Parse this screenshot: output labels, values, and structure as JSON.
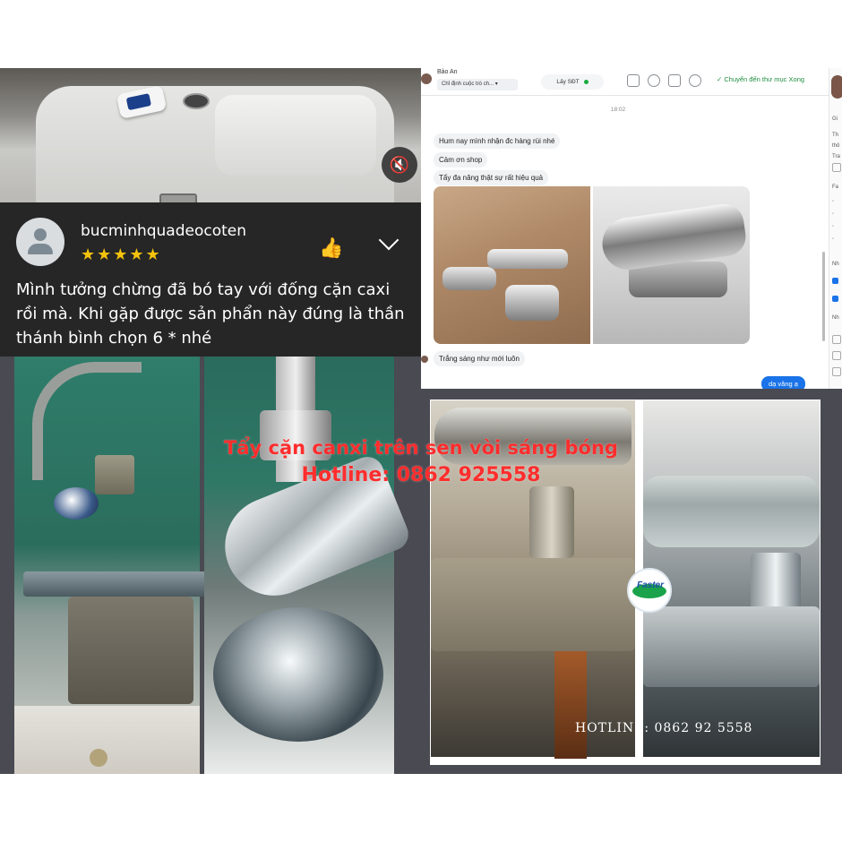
{
  "review": {
    "username": "bucminhquadeocoten",
    "stars": "★★★★★",
    "comment": "Mình tưởng chừng đã bó tay với đống cặn caxi rồi mà. Khi gặp được sản phẩn này đúng là thần thánh bình chọn 6 * nhé"
  },
  "chat": {
    "contact_name": "Bảo An",
    "dropdown_label": "Chỉ định cuộc trò ch...",
    "get_phone": "Lấy SĐT",
    "move_label": "Chuyển đến thư mục Xong",
    "time": "18:02",
    "messages": [
      "Hum nay mình nhận đc hàng rùi nhé",
      "Cảm ơn shop",
      "Tẩy đa năng thật sự rất hiệu quả",
      "Trắng sáng như mới luôn"
    ],
    "reply": "dạ vâng ạ"
  },
  "overlay": {
    "headline": "Tẩy cặn canxi trên sen vòi sáng bóng",
    "hotline": "Hotline: 0862 925558",
    "hotline_bottom": "HOTLINE: 0862 92 5558"
  },
  "logo_text": "Faster"
}
